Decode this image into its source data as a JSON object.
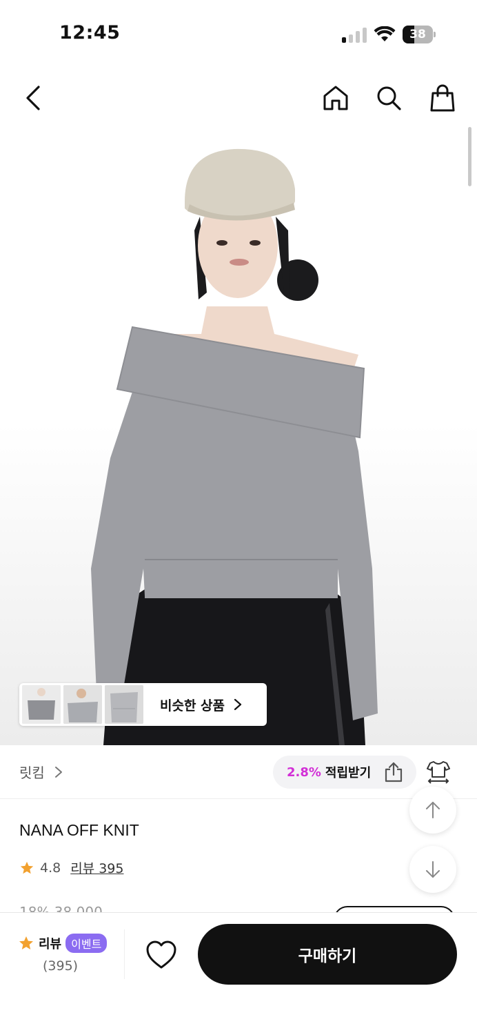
{
  "status_bar": {
    "time": "12:45",
    "battery_level": "38",
    "battery_fraction": 0.38,
    "signal_bars_active": 1
  },
  "top_nav": {
    "icons": [
      "back-icon",
      "home-icon",
      "search-icon",
      "shopping-bag-icon"
    ]
  },
  "hero": {
    "similar_products_label": "비슷한 상품",
    "thumbnails": [
      "thumbnail-1",
      "thumbnail-2",
      "thumbnail-3"
    ],
    "colors": {
      "sweater": "#9d9ea3",
      "cap": "#d8d2c4",
      "pants": "#17171a",
      "skin": "#efd9cb",
      "hair": "#1b1b1d"
    }
  },
  "brand": {
    "name": "릿킴"
  },
  "points": {
    "rate": "2.8%",
    "label": "적립받기"
  },
  "product": {
    "name": "NANA OFF KNIT",
    "rating": "4.8",
    "review_link": "리뷰 395",
    "price_partial": "18% 38,000"
  },
  "bottom_bar": {
    "review_label": "리뷰",
    "event_badge": "이벤트",
    "review_count": "(395)",
    "buy_label": "구매하기"
  },
  "colors": {
    "accent_points": "#d22fd6",
    "event_badge": "#8b6cf1",
    "star": "#f2a12f",
    "buy_button": "#111111"
  }
}
